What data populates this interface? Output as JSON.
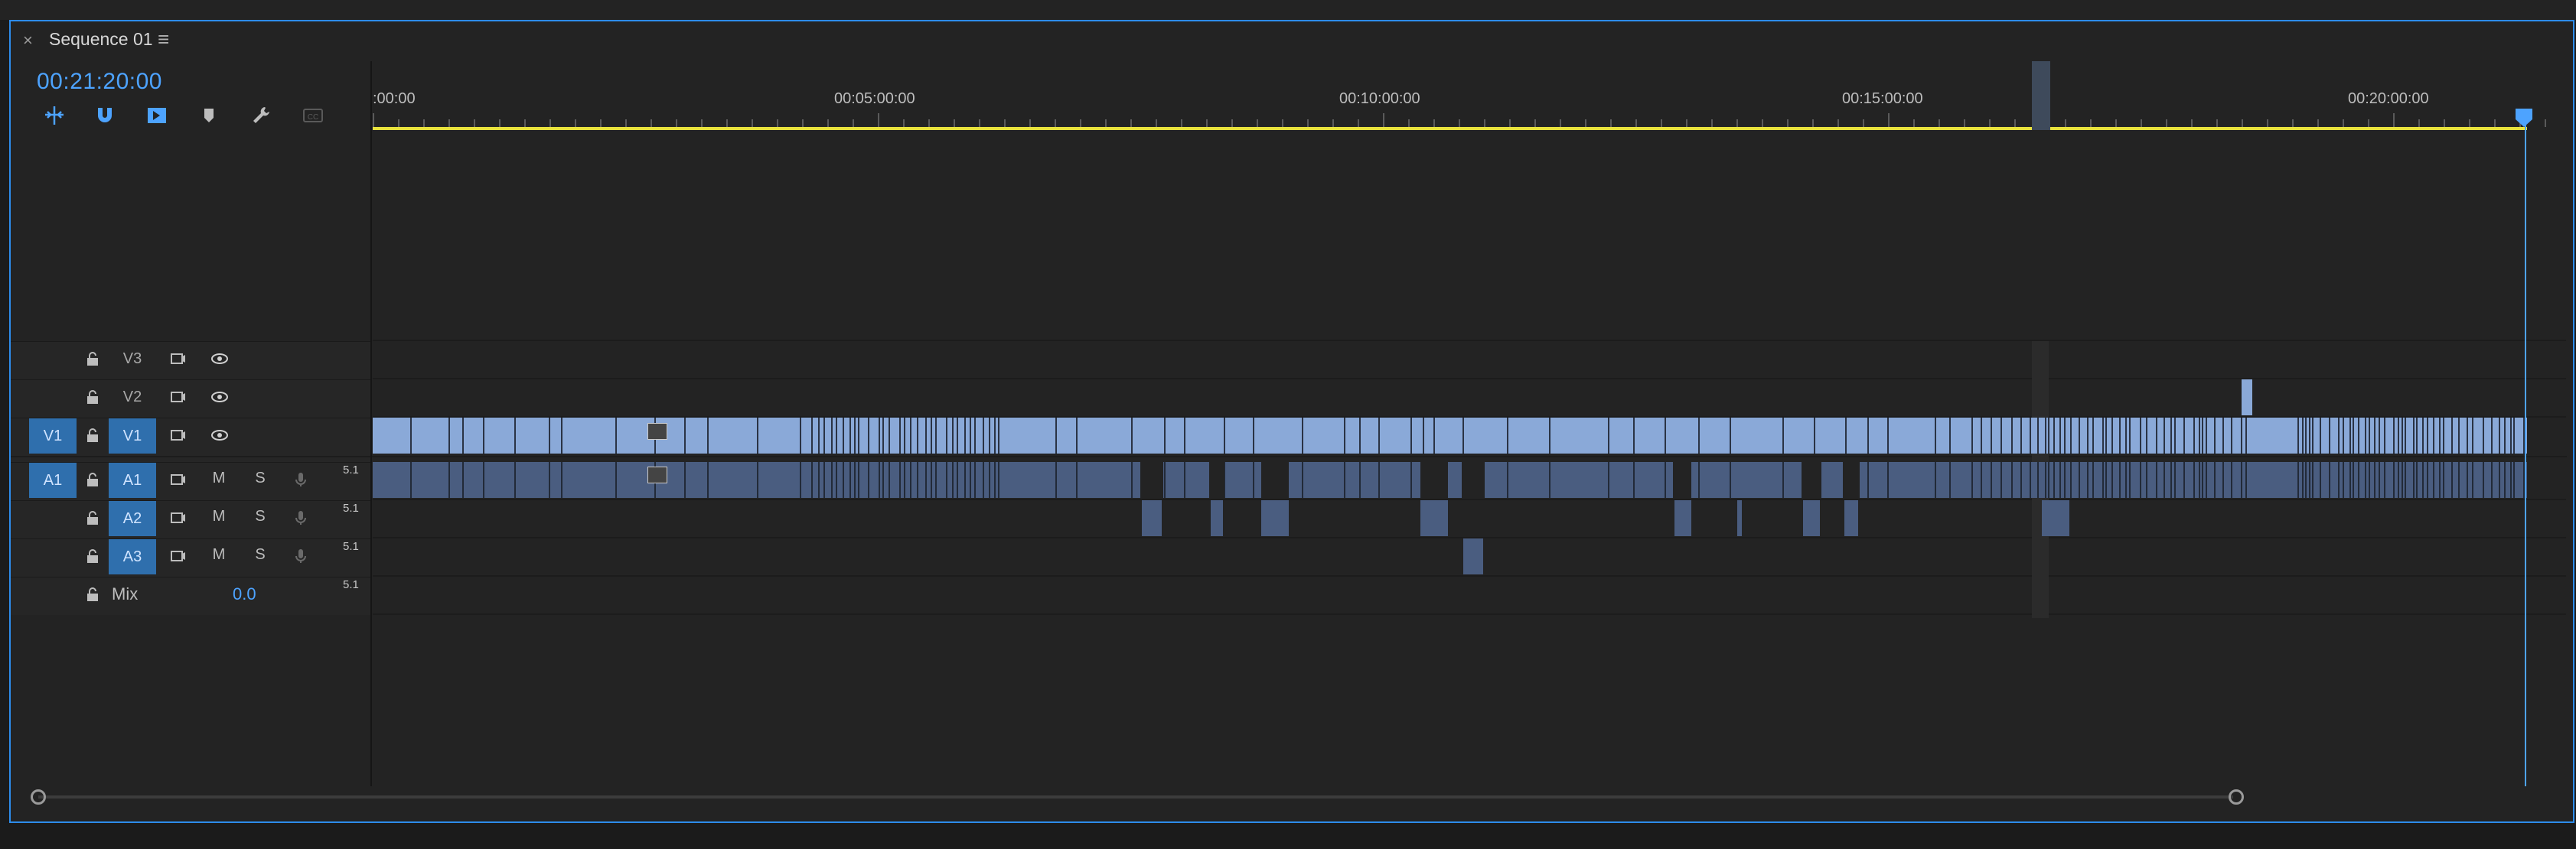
{
  "panel": {
    "title": "Sequence 01",
    "close_icon": "close-icon",
    "menu_icon": "hamburger-menu-icon",
    "timecode": "00:21:20:00"
  },
  "toolbar": {
    "tools": [
      {
        "name": "insert-overwrite-icon",
        "active": true
      },
      {
        "name": "snap-magnet-icon",
        "active": true
      },
      {
        "name": "linked-selection-icon",
        "active": true
      },
      {
        "name": "add-marker-icon",
        "active": false
      },
      {
        "name": "wrench-settings-icon",
        "active": false
      },
      {
        "name": "captions-icon",
        "active": false
      }
    ]
  },
  "ruler": {
    "labels": [
      ":00:00",
      "00:05:00:00",
      "00:10:00:00",
      "00:15:00:00",
      "00:20:00:00"
    ]
  },
  "tracks": {
    "video": [
      {
        "label": "V3",
        "target": ""
      },
      {
        "label": "V2",
        "target": ""
      },
      {
        "label": "V1",
        "target": "V1"
      }
    ],
    "audio": [
      {
        "label": "A1",
        "target": "A1",
        "channels": "5.1",
        "mute": "M",
        "solo": "S"
      },
      {
        "label": "A2",
        "target": "",
        "channels": "5.1",
        "mute": "M",
        "solo": "S"
      },
      {
        "label": "A3",
        "target": "",
        "channels": "5.1",
        "mute": "M",
        "solo": "S"
      }
    ],
    "mix": {
      "label": "Mix",
      "value": "0.0",
      "channels": "5.1"
    }
  },
  "colors": {
    "accent": "#4da3ff",
    "panel_border": "#2d8ceb",
    "video_clip": "#8aa9d8",
    "audio_clip": "#4a5d80",
    "work_area_bar": "#e8e23c",
    "track_target": "#2f6fad"
  }
}
